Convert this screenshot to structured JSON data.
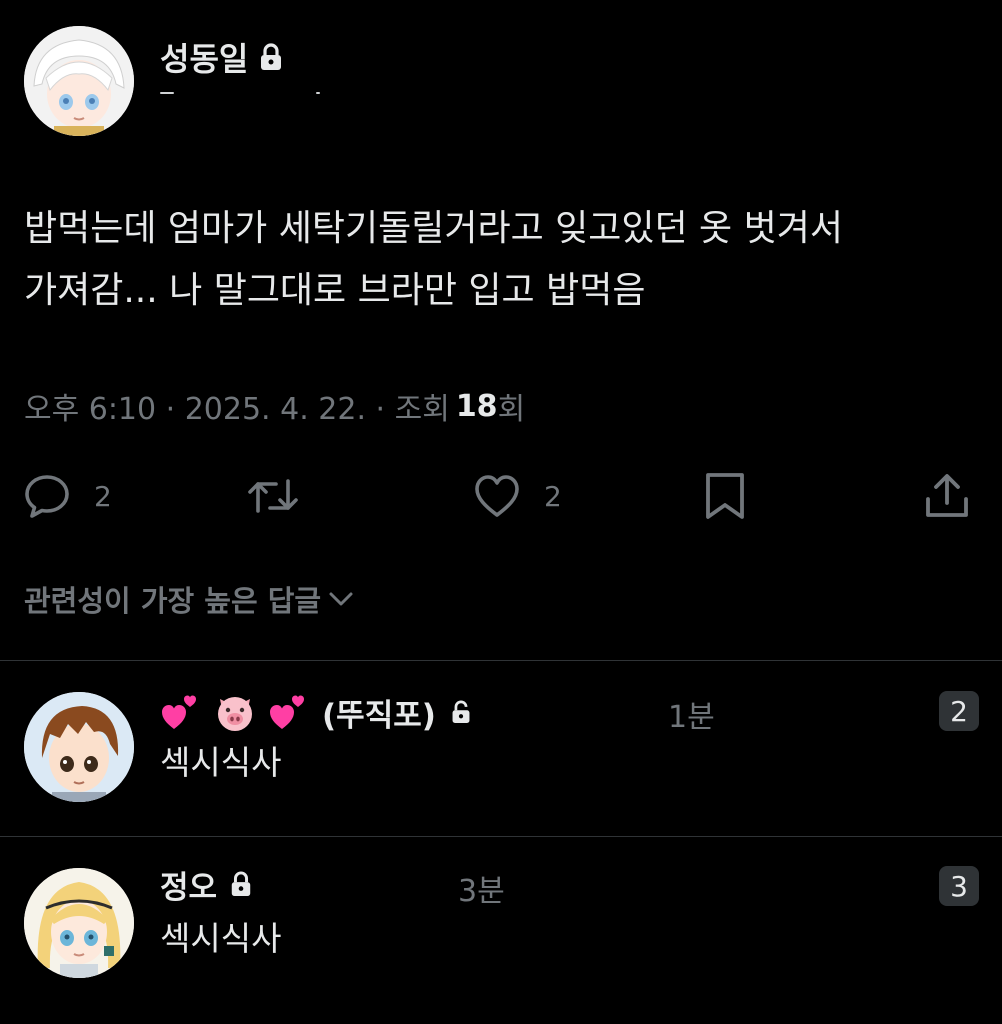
{
  "tweet": {
    "display_name": "성동일",
    "text": "밥먹는데 엄마가 세탁기돌릴거라고 잊고있던 옷 벗겨서\n가져감... 나 말그대로 브라만 입고 밥먹음",
    "time": "오후 6:10 · 2025. 4. 22. · 조회",
    "views": "18",
    "views_suffix": "회",
    "reply_count": "2",
    "like_count": "2"
  },
  "sort_label": "관련성이 가장 높은 답글",
  "replies": [
    {
      "display_name": "(뚜직포)",
      "name_emojis": [
        "pink-hearts-icon",
        "pig-face-icon",
        "pink-hearts-icon"
      ],
      "time": "1분",
      "text": "섹시식사",
      "badge": "2"
    },
    {
      "display_name": "정오",
      "time": "3분",
      "text": "섹시식사",
      "badge": "3"
    }
  ],
  "colors": {
    "background": "#000000",
    "text_primary": "#e7e9ea",
    "text_secondary": "#71767b",
    "divider": "#2f3336",
    "heart_pink": "#ff3fa4"
  }
}
